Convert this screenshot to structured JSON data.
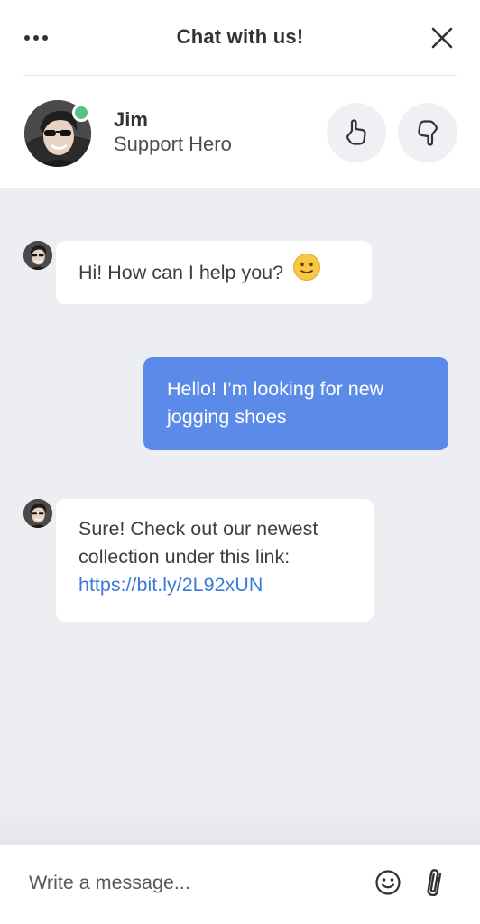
{
  "header": {
    "title": "Chat with us!",
    "menu_icon": "more-horizontal-icon",
    "close_icon": "close-icon"
  },
  "agent": {
    "name": "Jim",
    "role": "Support Hero",
    "status": "online",
    "status_color": "#57c08a",
    "rate_up_icon": "thumbs-up-icon",
    "rate_down_icon": "thumbs-down-icon"
  },
  "messages": [
    {
      "sender": "agent",
      "text": "Hi! How can I help you?",
      "emoji": "slightly-smiling-face-icon"
    },
    {
      "sender": "user",
      "text": "Hello! I’m looking for new jogging shoes"
    },
    {
      "sender": "agent",
      "lines": [
        "Sure! Check out our newest",
        "collection under this link:"
      ],
      "link": "https://bit.ly/2L92xUN"
    }
  ],
  "composer": {
    "placeholder": "Write a message...",
    "emoji_icon": "smiley-icon",
    "attach_icon": "paperclip-icon"
  },
  "colors": {
    "user_bubble": "#5b8ae8",
    "link": "#3d7adb",
    "conversation_bg": "#eceef2"
  }
}
